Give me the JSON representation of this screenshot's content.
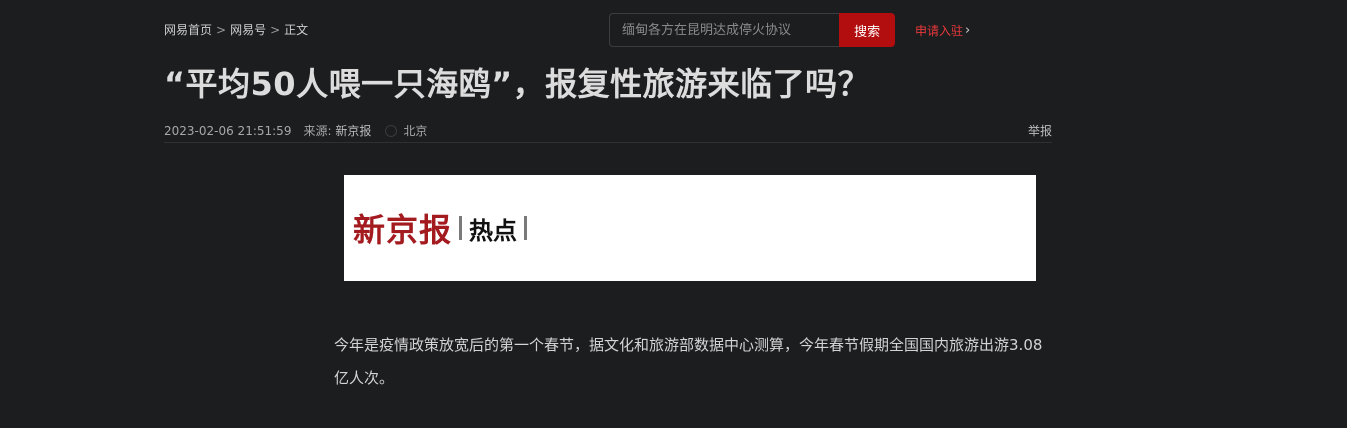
{
  "breadcrumb": {
    "home": "网易首页",
    "sep": ">",
    "channel": "网易号",
    "current": "正文"
  },
  "search": {
    "placeholder": "缅甸各方在昆明达成停火协议",
    "button_label": "搜索"
  },
  "apply_link": {
    "label": "申请入驻",
    "chevron": "›"
  },
  "article": {
    "title": "“平均50人喂一只海鸥”，报复性旅游来临了吗？",
    "time": "2023-02-06 21:51:59",
    "source_label": "来源:",
    "source_name": "新京报",
    "location": "北京",
    "report_label": "举报",
    "banner": {
      "brand": "新京报",
      "tag": "热点"
    },
    "paragraph": "今年是疫情政策放宽后的第一个春节，据文化和旅游部数据中心测算，今年春节假期全国国内旅游出游3.08亿人次。"
  },
  "colors": {
    "background": "#1c1d1f",
    "accent_red": "#b20e10",
    "link_red": "#e8393b",
    "brand_red": "#a31a1f"
  }
}
